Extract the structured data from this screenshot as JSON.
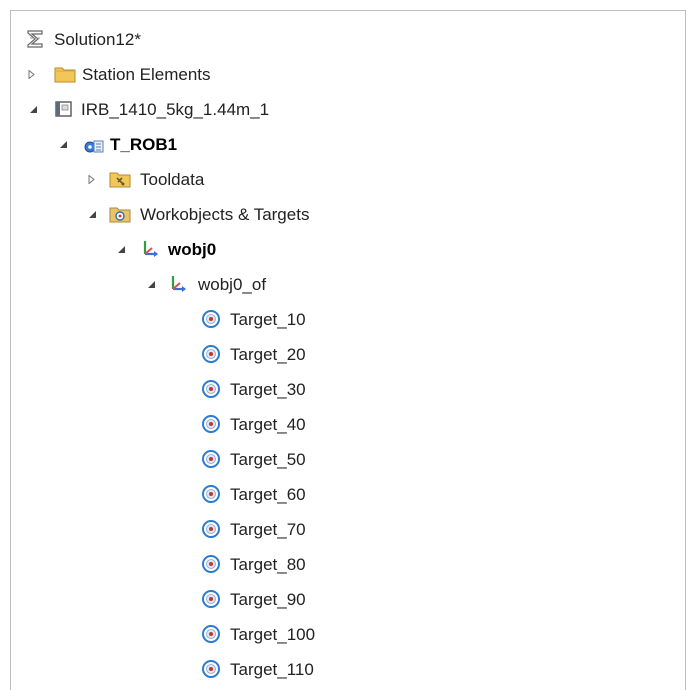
{
  "tree": {
    "solution": {
      "label": "Solution12*",
      "icon": "solution-icon"
    },
    "station_elements": {
      "label": "Station Elements",
      "icon": "folder-icon",
      "expanded": false
    },
    "robot": {
      "label": "IRB_1410_5kg_1.44m_1",
      "icon": "robot-controller-icon",
      "expanded": true
    },
    "task": {
      "label": "T_ROB1",
      "icon": "task-icon",
      "expanded": true
    },
    "tooldata": {
      "label": "Tooldata",
      "icon": "tooldata-folder-icon",
      "expanded": false
    },
    "workobjects": {
      "label": "Workobjects & Targets",
      "icon": "workobjects-folder-icon",
      "expanded": true
    },
    "wobj0": {
      "label": "wobj0",
      "icon": "frame-icon",
      "expanded": true
    },
    "wobj0_of": {
      "label": "wobj0_of",
      "icon": "frame-icon",
      "expanded": true
    },
    "targets": [
      {
        "label": "Target_10",
        "icon": "target-icon"
      },
      {
        "label": "Target_20",
        "icon": "target-icon"
      },
      {
        "label": "Target_30",
        "icon": "target-icon"
      },
      {
        "label": "Target_40",
        "icon": "target-icon"
      },
      {
        "label": "Target_50",
        "icon": "target-icon"
      },
      {
        "label": "Target_60",
        "icon": "target-icon"
      },
      {
        "label": "Target_70",
        "icon": "target-icon"
      },
      {
        "label": "Target_80",
        "icon": "target-icon"
      },
      {
        "label": "Target_90",
        "icon": "target-icon"
      },
      {
        "label": "Target_100",
        "icon": "target-icon"
      },
      {
        "label": "Target_110",
        "icon": "target-icon"
      }
    ]
  },
  "colors": {
    "expander": "#555555",
    "folder": "#e8b94a",
    "target_ring": "#2b7bd0",
    "target_center": "#c0392b",
    "frame_z": "#2e9e3f",
    "frame_x": "#3b6fd6"
  }
}
